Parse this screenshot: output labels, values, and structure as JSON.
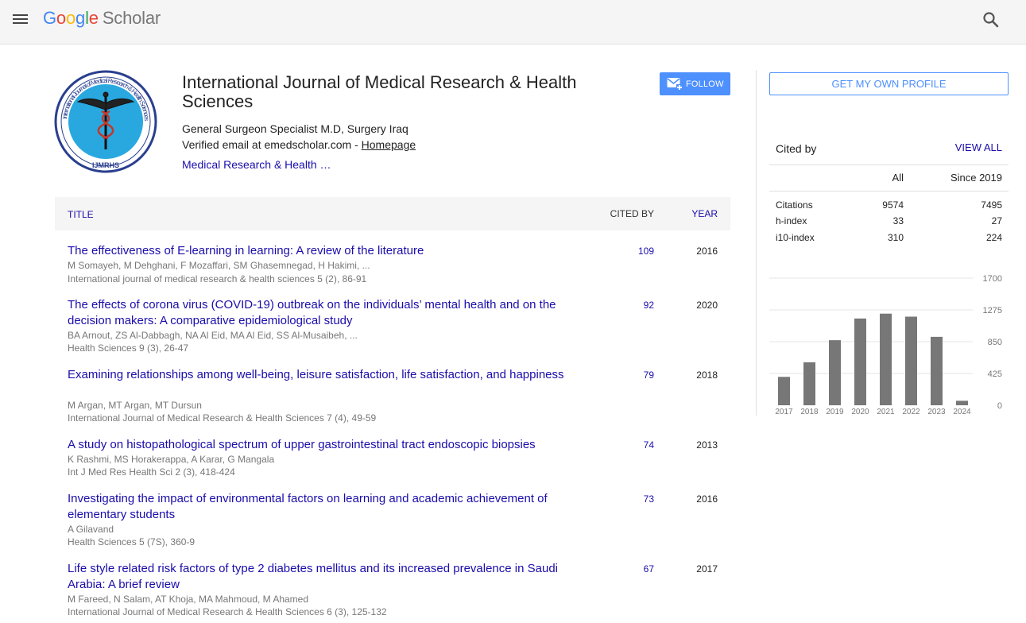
{
  "header": {
    "logo_letters": [
      "G",
      "o",
      "o",
      "g",
      "l",
      "e"
    ],
    "logo_suffix": "Scholar",
    "menu_icon": "menu-icon",
    "search_icon": "search-icon"
  },
  "profile": {
    "name": "International Journal of Medical Research & Health Sciences",
    "affiliation": "General Surgeon Specialist M.D, Surgery Iraq",
    "email_prefix": "Verified email at emedscholar.com - ",
    "homepage_label": "Homepage",
    "interest": "Medical Research & Health …",
    "follow_label": "FOLLOW",
    "avatar_text_top": "International Journal of Medical Research & Health Sciences",
    "avatar_text_bottom": "IJMRHS"
  },
  "table": {
    "col_title": "TITLE",
    "col_cited": "CITED BY",
    "col_year": "YEAR",
    "rows": [
      {
        "title": "The effectiveness of E-learning in learning: A review of the literature",
        "authors": "M Somayeh, M Dehghani, F Mozaffari, SM Ghasemnegad, H Hakimi, ...",
        "venue": "International journal of medical research & health sciences 5 (2), 86-91",
        "cited": "109",
        "year": "2016"
      },
      {
        "title": "The effects of corona virus (COVID-19) outbreak on the individuals’ mental health and on the decision makers: A comparative epidemiological study",
        "authors": "BA Arnout, ZS Al-Dabbagh, NA Al Eid, MA Al Eid, SS Al-Musaibeh, ...",
        "venue": "Health Sciences 9 (3), 26-47",
        "cited": "92",
        "year": "2020"
      },
      {
        "title": "Examining relationships among well-being, leisure satisfaction, life satisfaction, and happiness",
        "authors": "M Argan, MT Argan, MT Dursun",
        "venue": "International Journal of Medical Research & Health Sciences 7 (4), 49-59",
        "cited": "79",
        "year": "2018"
      },
      {
        "title": "A study on histopathological spectrum of upper gastrointestinal tract endoscopic biopsies",
        "authors": "K Rashmi, MS Horakerappa, A Karar, G Mangala",
        "venue": "Int J Med Res Health Sci 2 (3), 418-424",
        "cited": "74",
        "year": "2013"
      },
      {
        "title": "Investigating the impact of environmental factors on learning and academic achievement of elementary students",
        "authors": "A Gilavand",
        "venue": "Health Sciences 5 (7S), 360-9",
        "cited": "73",
        "year": "2016"
      },
      {
        "title": "Life style related risk factors of type 2 diabetes mellitus and its increased prevalence in Saudi Arabia: A brief review",
        "authors": "M Fareed, N Salam, AT Khoja, MA Mahmoud, M Ahamed",
        "venue": "International Journal of Medical Research & Health Sciences 6 (3), 125-132",
        "cited": "67",
        "year": "2017"
      }
    ]
  },
  "sidebar": {
    "own_profile_label": "GET MY OWN PROFILE",
    "cited_by_label": "Cited by",
    "view_all_label": "VIEW ALL",
    "col_all": "All",
    "col_since": "Since 2019",
    "stats": [
      {
        "label": "Citations",
        "all": "9574",
        "since": "7495"
      },
      {
        "label": "h-index",
        "all": "33",
        "since": "27"
      },
      {
        "label": "i10-index",
        "all": "310",
        "since": "224"
      }
    ]
  },
  "colors": {
    "link": "#1a0dab",
    "accent": "#4d90fe",
    "bar": "#777777"
  },
  "chart_data": {
    "type": "bar",
    "categories": [
      "2017",
      "2018",
      "2019",
      "2020",
      "2021",
      "2022",
      "2023",
      "2024"
    ],
    "values": [
      380,
      575,
      870,
      1160,
      1225,
      1185,
      915,
      60
    ],
    "yticks": [
      "0",
      "425",
      "850",
      "1275",
      "1700"
    ],
    "ylim": [
      0,
      1700
    ],
    "grid": true,
    "y_axis_side": "right"
  }
}
